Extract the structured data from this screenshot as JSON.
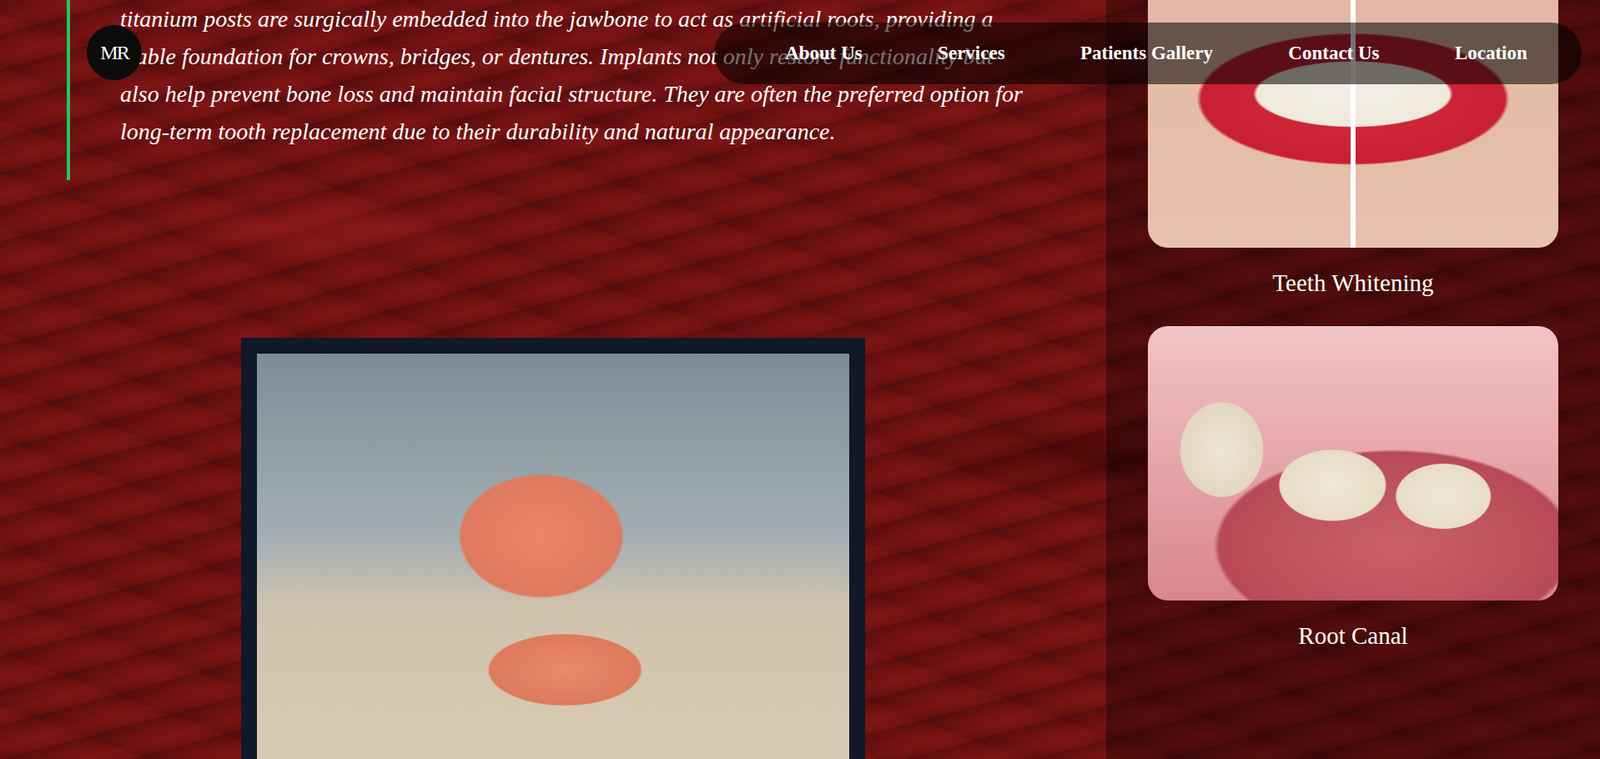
{
  "logo": "MR",
  "nav": {
    "items": [
      "About Us",
      "Services",
      "Patients Gallery",
      "Contact Us",
      "Location"
    ]
  },
  "quote": "titanium posts are surgically embedded into the jawbone to act as artificial roots, providing a stable foundation for crowns, bridges, or dentures. Implants not only restore functionality but also help prevent bone loss and maintain facial structure. They are often the preferred option for long-term tooth replacement due to their durability and natural appearance.",
  "services": [
    {
      "label": "Teeth Whitening"
    },
    {
      "label": "Root Canal"
    }
  ]
}
